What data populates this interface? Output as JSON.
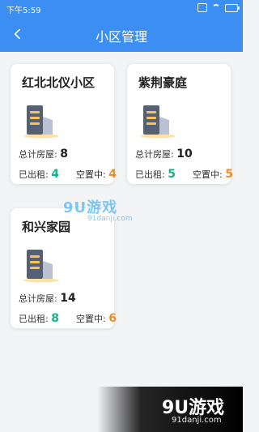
{
  "status": {
    "time": "下午5:59"
  },
  "header": {
    "title": "小区管理"
  },
  "cards": [
    {
      "name": "红北北仪小区",
      "total_label": "总计房屋:",
      "total_value": "8",
      "rented_label": "已出租:",
      "rented_value": "4",
      "vacant_label": "空置中:",
      "vacant_value": "4"
    },
    {
      "name": "紫荆豪庭",
      "total_label": "总计房屋:",
      "total_value": "10",
      "rented_label": "已出租:",
      "rented_value": "5",
      "vacant_label": "空置中:",
      "vacant_value": "5"
    },
    {
      "name": "和兴家园",
      "total_label": "总计房屋:",
      "total_value": "14",
      "rented_label": "已出租:",
      "rented_value": "8",
      "vacant_label": "空置中:",
      "vacant_value": "6"
    }
  ],
  "watermark": {
    "center_logo": "9U游戏",
    "center_site": "91danji.com",
    "corner_logo": "9U游戏",
    "corner_site": "91danji.com"
  },
  "colors": {
    "primary": "#3c8ef3",
    "rented": "#16b48c",
    "vacant": "#f08b24"
  }
}
